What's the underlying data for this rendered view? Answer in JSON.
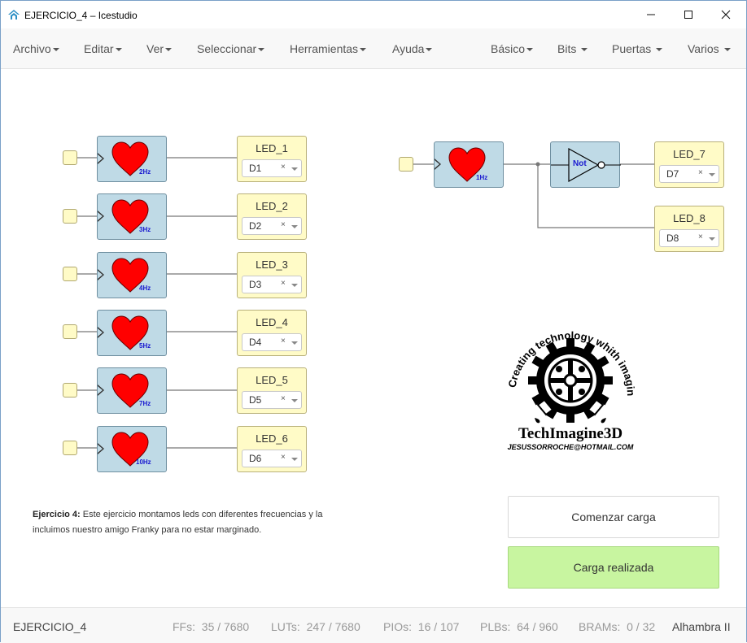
{
  "window": {
    "title": "EJERCICIO_4 – Icestudio"
  },
  "menus": [
    {
      "label": "Archivo"
    },
    {
      "label": "Editar"
    },
    {
      "label": "Ver"
    },
    {
      "label": "Seleccionar"
    },
    {
      "label": "Herramientas"
    },
    {
      "label": "Ayuda"
    },
    {
      "label": "Básico"
    },
    {
      "label": "Bits"
    },
    {
      "label": "Puertas"
    },
    {
      "label": "Varios"
    }
  ],
  "clocks": [
    {
      "freq": "2Hz"
    },
    {
      "freq": "3Hz"
    },
    {
      "freq": "4Hz"
    },
    {
      "freq": "5Hz"
    },
    {
      "freq": "7Hz"
    },
    {
      "freq": "10Hz"
    },
    {
      "freq": "1Hz"
    }
  ],
  "leds": [
    {
      "name": "LED_1",
      "pin": "D1"
    },
    {
      "name": "LED_2",
      "pin": "D2"
    },
    {
      "name": "LED_3",
      "pin": "D3"
    },
    {
      "name": "LED_4",
      "pin": "D4"
    },
    {
      "name": "LED_5",
      "pin": "D5"
    },
    {
      "name": "LED_6",
      "pin": "D6"
    },
    {
      "name": "LED_7",
      "pin": "D7"
    },
    {
      "name": "LED_8",
      "pin": "D8"
    }
  ],
  "pin_clear": "×",
  "not_gate": {
    "label": "Not"
  },
  "description": {
    "bold": "Ejercicio 4:",
    "text": " Este ejercicio montamos leds con diferentes frecuencias y la incluimos nuestro amigo Franky para no estar marginado."
  },
  "logo": {
    "arc_text": "Creating technology whith imagination",
    "brand": "TechImagine3D",
    "email": "JESUSSORROCHE@HOTMAIL.COM"
  },
  "buttons": {
    "start": "Comenzar carga",
    "done": "Carga realizada"
  },
  "footer": {
    "project": "EJERCICIO_4",
    "ffs_label": "FFs:",
    "ffs": "35 / 7680",
    "luts_label": "LUTs:",
    "luts": "247 / 7680",
    "pios_label": "PIOs:",
    "pios": "16 / 107",
    "plbs_label": "PLBs:",
    "plbs": "64 / 960",
    "brams_label": "BRAMs:",
    "brams": "0 / 32",
    "board": "Alhambra II"
  },
  "colors": {
    "clock_block": "#bfdae6",
    "led_block": "#fffbc7",
    "heart": "#ff0000",
    "done_button": "#c8f5a0",
    "freq_text": "#1a1ad0"
  }
}
